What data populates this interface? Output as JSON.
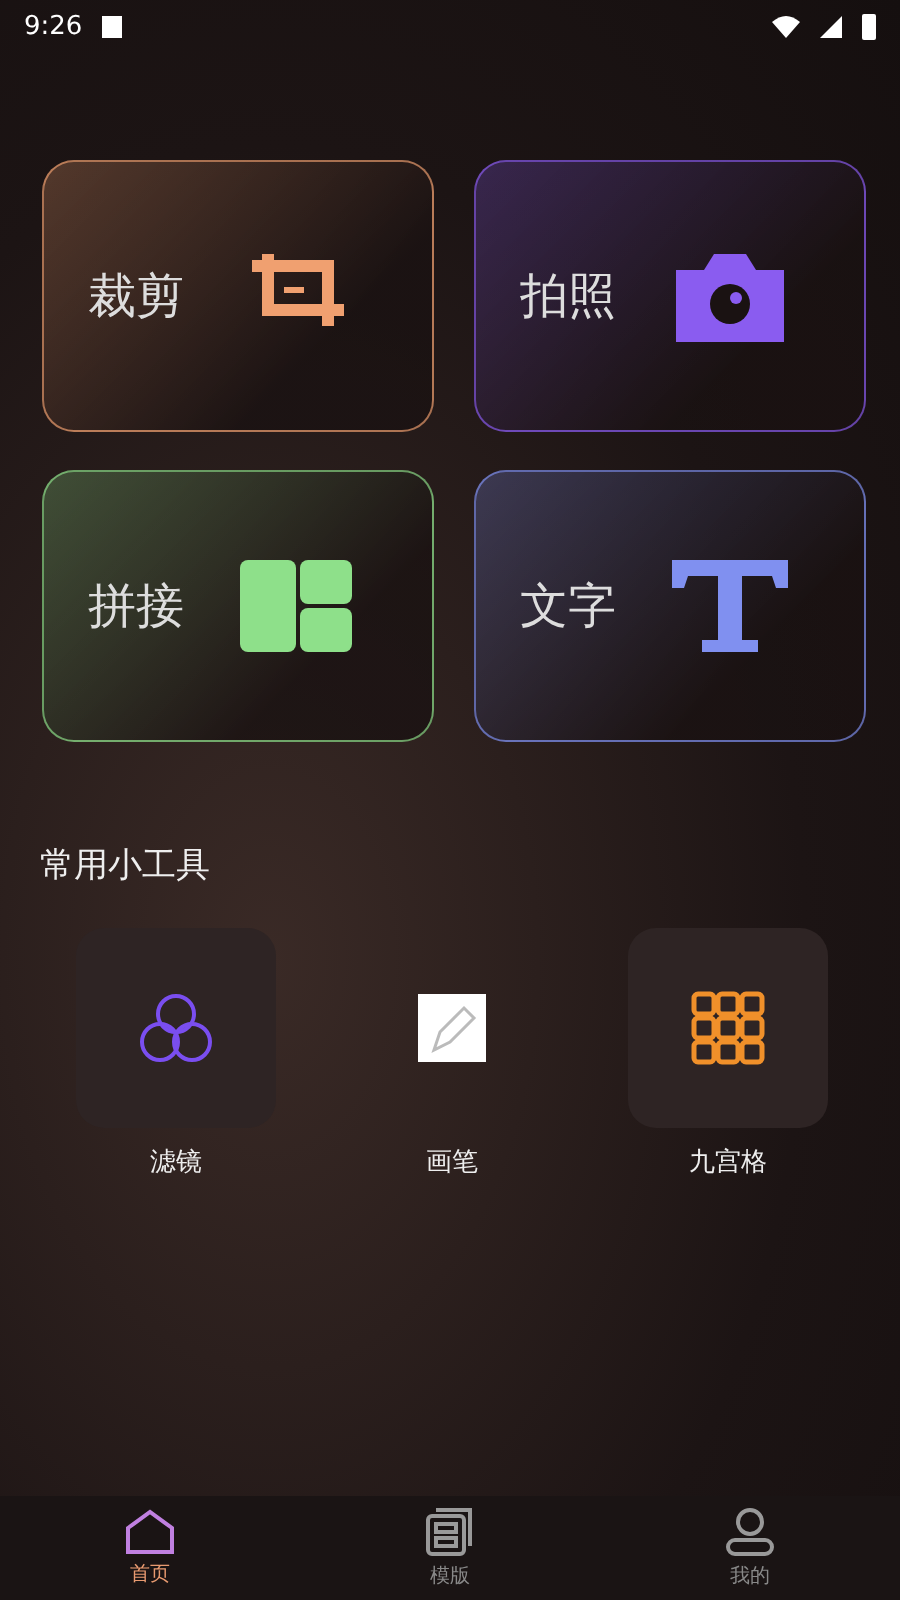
{
  "status_bar": {
    "time": "9:26"
  },
  "feature_cards": [
    {
      "label": "裁剪",
      "kind": "crop",
      "color": "#f0a070"
    },
    {
      "label": "拍照",
      "kind": "camera",
      "color": "#8a5cf0"
    },
    {
      "label": "拼接",
      "kind": "collage",
      "color": "#8ee08a"
    },
    {
      "label": "文字",
      "kind": "text",
      "color": "#8090f0"
    }
  ],
  "tools_section": {
    "title": "常用小工具",
    "tools": [
      {
        "label": "滤镜",
        "kind": "filter"
      },
      {
        "label": "画笔",
        "kind": "pencil"
      },
      {
        "label": "九宫格",
        "kind": "grid"
      }
    ]
  },
  "bottom_nav": [
    {
      "label": "首页",
      "kind": "home",
      "selected": true
    },
    {
      "label": "模版",
      "kind": "template",
      "selected": false
    },
    {
      "label": "我的",
      "kind": "profile",
      "selected": false
    }
  ]
}
